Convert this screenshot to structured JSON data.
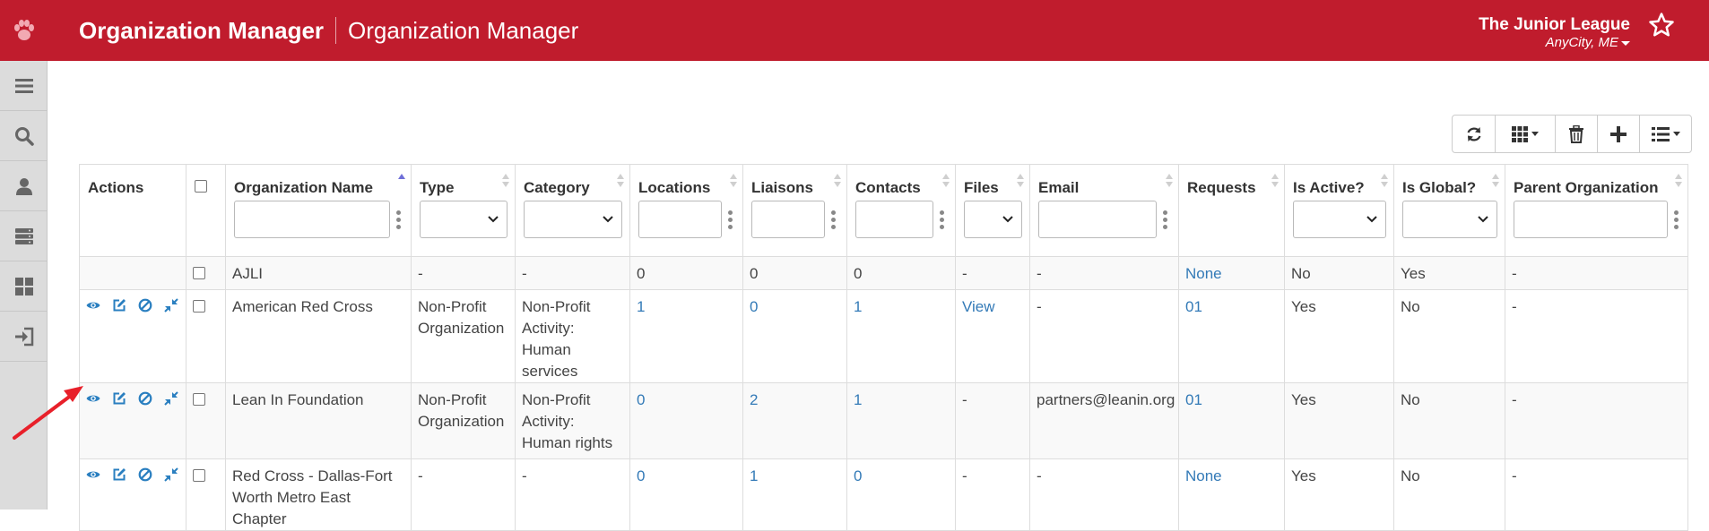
{
  "header": {
    "app_title": "Organization Manager",
    "page_title": "Organization Manager",
    "org_name": "The Junior League",
    "org_location": "AnyCity, ME",
    "brand_color": "#c01c2d"
  },
  "sidebar": {
    "items": [
      {
        "icon": "menu-icon"
      },
      {
        "icon": "search-icon"
      },
      {
        "icon": "user-icon"
      },
      {
        "icon": "server-icon"
      },
      {
        "icon": "dashboard-icon"
      },
      {
        "icon": "logout-icon"
      }
    ]
  },
  "toolbar": {
    "buttons": [
      "refresh-icon",
      "columns-icon",
      "trash-icon",
      "plus-icon",
      "list-icon"
    ]
  },
  "table": {
    "columns": [
      "Actions",
      "",
      "Organization Name",
      "Type",
      "Category",
      "Locations",
      "Liaisons",
      "Contacts",
      "Files",
      "Email",
      "Requests",
      "Is Active?",
      "Is Global?",
      "Parent Organization"
    ],
    "rows": [
      {
        "name": "AJLI",
        "type": "-",
        "category": "-",
        "locations": "0",
        "liaisons": "0",
        "contacts": "0",
        "files": "-",
        "email": "-",
        "requests": "None",
        "active": "No",
        "global": "Yes",
        "parent": "-"
      },
      {
        "name": "American Red Cross",
        "type": "Non-Profit Organization",
        "category": "Non-Profit Activity: Human services",
        "locations": "1",
        "liaisons": "0",
        "contacts": "1",
        "files": "View",
        "email": "-",
        "requests": "01",
        "active": "Yes",
        "global": "No",
        "parent": "-"
      },
      {
        "name": "Lean In Foundation",
        "type": "Non-Profit Organization",
        "category": "Non-Profit Activity: Human rights",
        "locations": "0",
        "liaisons": "2",
        "contacts": "1",
        "files": "-",
        "email": "partners@leanin.org",
        "requests": "01",
        "active": "Yes",
        "global": "No",
        "parent": "-"
      },
      {
        "name": "Red Cross - Dallas-Fort Worth Metro East Chapter",
        "type": "-",
        "category": "-",
        "locations": "0",
        "liaisons": "1",
        "contacts": "0",
        "files": "-",
        "email": "-",
        "requests": "None",
        "active": "Yes",
        "global": "No",
        "parent": "-"
      }
    ]
  },
  "colors": {
    "link": "#337ab7",
    "action_icons": "#2a7fc0",
    "annotation_arrow": "#e8202a"
  }
}
